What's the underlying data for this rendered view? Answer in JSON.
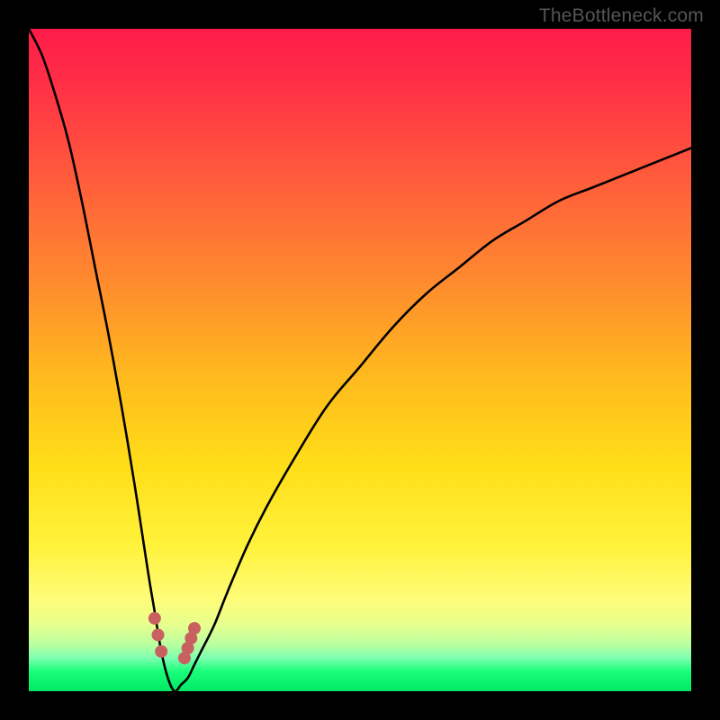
{
  "watermark": "TheBottleneck.com",
  "colors": {
    "frame": "#000000",
    "curve": "#000000",
    "marker": "#c96060",
    "gradient_top": "#ff1c4a",
    "gradient_bottom": "#00e865"
  },
  "chart_data": {
    "type": "line",
    "title": "",
    "xlabel": "",
    "ylabel": "",
    "xlim": [
      0,
      100
    ],
    "ylim": [
      0,
      100
    ],
    "note": "Bottleneck-style V curve. y≈0 at the optimum point x≈22; rises steeply to ~100 as x→0 and asymptotically toward ~82 as x→100. Values estimated from pixel positions.",
    "series": [
      {
        "name": "bottleneck-curve",
        "x": [
          0,
          2,
          4,
          6,
          8,
          10,
          12,
          14,
          16,
          18,
          19,
          20,
          21,
          22,
          23,
          24,
          25,
          26,
          28,
          30,
          33,
          36,
          40,
          45,
          50,
          55,
          60,
          65,
          70,
          75,
          80,
          85,
          90,
          95,
          100
        ],
        "y": [
          100,
          96,
          90,
          83,
          74,
          64,
          54,
          43,
          31,
          18,
          12,
          6,
          2,
          0,
          1,
          2,
          4,
          6,
          10,
          15,
          22,
          28,
          35,
          43,
          49,
          55,
          60,
          64,
          68,
          71,
          74,
          76,
          78,
          80,
          82
        ]
      }
    ],
    "markers": {
      "name": "near-optimum-points",
      "x": [
        19.0,
        19.5,
        20.0,
        23.5,
        24.0,
        24.5,
        25.0
      ],
      "y": [
        11.0,
        8.5,
        6.0,
        5.0,
        6.5,
        8.0,
        9.5
      ]
    }
  }
}
